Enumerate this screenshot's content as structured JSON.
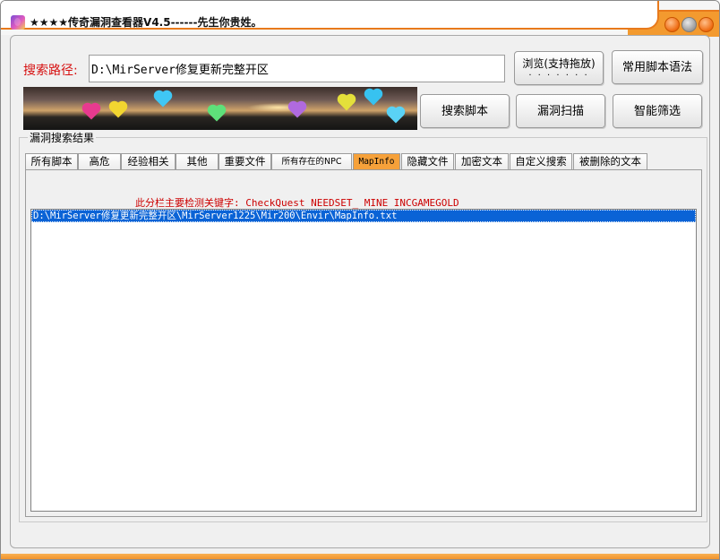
{
  "window": {
    "title": "★★★★传奇漏洞查看器V4.5------先生你贵姓。",
    "accent_color": "#f39a2f",
    "controls": [
      "minimize-icon",
      "maximize-icon",
      "close-icon"
    ]
  },
  "search": {
    "path_label": "搜索路径:",
    "path_value": "D:\\MirServer修复更新完整开区"
  },
  "buttons": {
    "browse_label": "浏览(支持拖放)",
    "browse_dots": "· · · · · · ·",
    "syntax_label": "常用脚本语法",
    "search_label": "搜索脚本",
    "scan_label": "漏洞扫描",
    "smart_label": "智能筛选"
  },
  "results": {
    "group_label": "漏洞搜索结果",
    "tabs": [
      {
        "label": "所有脚本"
      },
      {
        "label": "高危"
      },
      {
        "label": "经验相关"
      },
      {
        "label": "其他"
      },
      {
        "label": "重要文件"
      },
      {
        "label": "所有存在的NPC"
      },
      {
        "label": "MapInfo"
      },
      {
        "label": "隐藏文件"
      },
      {
        "label": "加密文本"
      },
      {
        "label": "自定义搜索"
      },
      {
        "label": "被删除的文本"
      }
    ],
    "active_tab": "MapInfo",
    "hint": "此分栏主要检测关键字: CheckQuest NEEDSET_ MINE INCGAMEGOLD",
    "items": [
      "D:\\MirServer修复更新完整开区\\MirServer1225\\Mir200\\Envir\\MapInfo.txt"
    ]
  }
}
